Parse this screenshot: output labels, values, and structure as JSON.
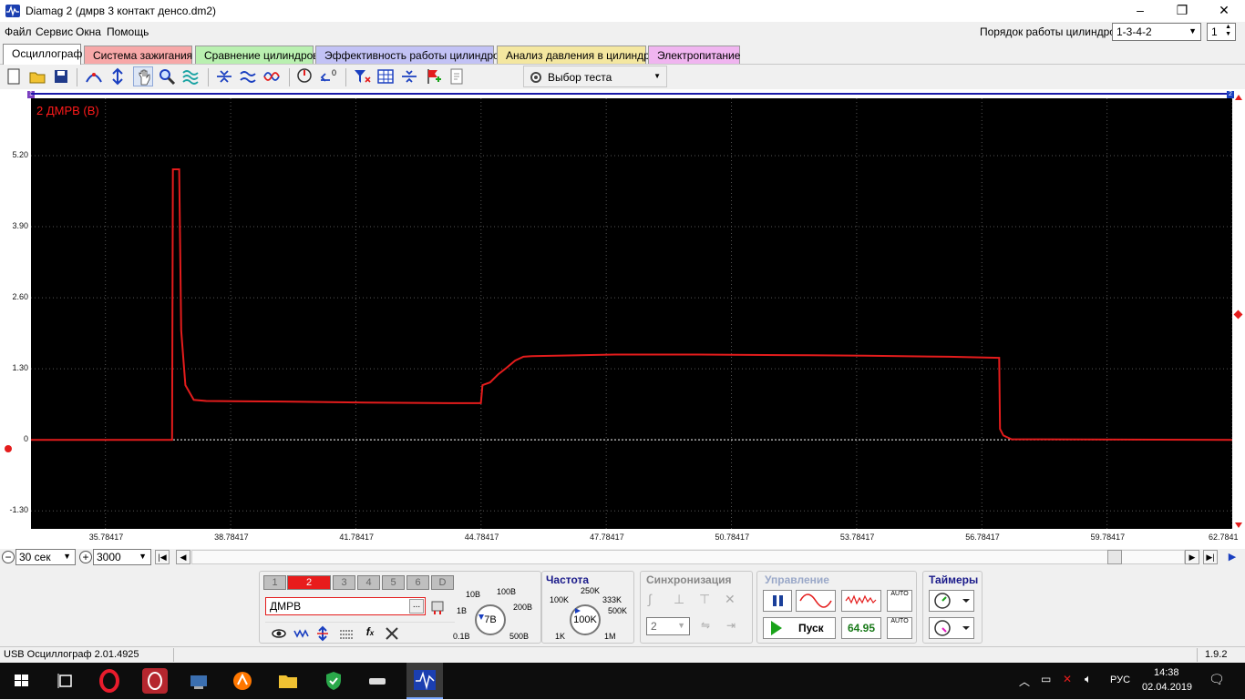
{
  "window": {
    "title": "Diamag 2 (дмрв 3 контакт денсо.dm2)",
    "minimize": "–",
    "restore": "❐",
    "close": "✕"
  },
  "menu": [
    "Файл",
    "Сервис",
    "Окна",
    "Помощь"
  ],
  "cylinder_order": {
    "label": "Порядок работы цилиндров",
    "value": "1-3-4-2",
    "cylinder": "1"
  },
  "tabs": [
    {
      "label": "Осциллограф",
      "color": "#ffffff"
    },
    {
      "label": "Система зажигания",
      "color": "#f7a8a8"
    },
    {
      "label": "Сравнение цилиндров",
      "color": "#b9f0b0"
    },
    {
      "label": "Эффективность работы цилиндров",
      "color": "#c2c2f5"
    },
    {
      "label": "Анализ давления в цилиндре",
      "color": "#f4e7a0"
    },
    {
      "label": "Электропитание",
      "color": "#f0b5f0"
    }
  ],
  "toolbar": {
    "test_select": "Выбор теста"
  },
  "oscilloscope": {
    "channel_label": "2 ДМРВ (В)",
    "trace_color": "#e41c1c",
    "y_ticks": [
      "5.20",
      "3.90",
      "2.60",
      "1.30",
      "0",
      "-1.30"
    ],
    "x_ticks": [
      "35.78417",
      "38.78417",
      "41.78417",
      "44.78417",
      "47.78417",
      "50.78417",
      "53.78417",
      "56.78417",
      "59.78417",
      "62.7841"
    ],
    "marker_top_left": "1",
    "marker_top_right": "2"
  },
  "chart_data": {
    "type": "line",
    "title": "2 ДМРВ (В)",
    "xlabel": "",
    "ylabel": "",
    "xlim": [
      34.0,
      62.78417
    ],
    "ylim": [
      -1.63,
      6.25
    ],
    "series": [
      {
        "name": "2 ДМРВ (В)",
        "color": "#e41c1c",
        "x": [
          34.0,
          37.38,
          37.4,
          37.55,
          37.6,
          37.7,
          37.9,
          38.2,
          40.0,
          42.0,
          44.0,
          44.78,
          44.82,
          45.0,
          45.2,
          45.4,
          45.6,
          45.8,
          46.0,
          48.0,
          50.0,
          52.0,
          54.0,
          56.0,
          57.2,
          57.22,
          57.3,
          57.5,
          62.78
        ],
        "y": [
          0,
          0,
          4.95,
          4.95,
          2.0,
          1.0,
          0.73,
          0.71,
          0.7,
          0.68,
          0.67,
          0.67,
          1.0,
          1.05,
          1.2,
          1.32,
          1.45,
          1.52,
          1.53,
          1.56,
          1.56,
          1.55,
          1.54,
          1.52,
          1.5,
          0.2,
          0.08,
          0.01,
          0.0
        ]
      }
    ],
    "grid": true
  },
  "timebase": {
    "value": "30 сек",
    "samples": "3000"
  },
  "channels": {
    "buttons": [
      "1",
      "2",
      "3",
      "4",
      "5",
      "6",
      "D"
    ],
    "active": "2",
    "name": "ДМРВ",
    "name_btn": "...",
    "voltage_dial": {
      "value": "7В",
      "labels": [
        "10В",
        "100В",
        "1В",
        "200В",
        "0.1В",
        "500В"
      ]
    }
  },
  "frequency": {
    "title": "Частота",
    "value": "100K",
    "labels": [
      "250K",
      "100K",
      "333K",
      "500K",
      "1K",
      "1M"
    ]
  },
  "sync": {
    "title": "Синхронизация",
    "channel": "2"
  },
  "control": {
    "title": "Управление",
    "run_label": "Пуск",
    "readout": "64.95",
    "auto": "AUTO"
  },
  "timers": {
    "title": "Таймеры"
  },
  "status": {
    "device": "USB Осциллограф  2.01.4925",
    "version": "1.9.2"
  },
  "taskbar": {
    "lang": "РУС",
    "time": "14:38",
    "date": "02.04.2019"
  }
}
